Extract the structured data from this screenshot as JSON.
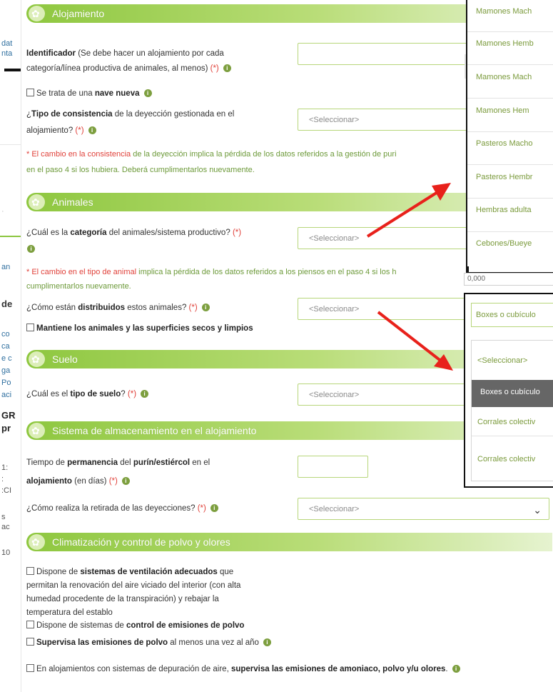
{
  "left_fragments": [
    "dat",
    "nta",
    "an",
    "de",
    "co",
    "ca",
    "e c",
    "ga",
    "Po",
    "aci",
    "GR",
    "pr",
    "1:",
    ":",
    ":CI",
    "s",
    "ac",
    "10"
  ],
  "sections": {
    "alojamiento": "Alojamiento",
    "animales": "Animales",
    "suelo": "Suelo",
    "almacenamiento": "Sistema de almacenamiento en el alojamiento",
    "climatizacion": "Climatización y control de polvo y olores"
  },
  "alojamiento": {
    "identificador_label": "Identificador",
    "identificador_note_1": " (Se debe hacer un alojamiento por cada",
    "identificador_note_2": "categoría/línea productiva de animales, al menos)",
    "required_mark": "(*)",
    "nave_nueva_prefix": "Se trata de una ",
    "nave_nueva_bold": "nave nueva",
    "tipo_pre": "¿",
    "tipo_bold": "Tipo de consistencia",
    "tipo_post": " de la deyección gestionada en el",
    "tipo_line2": "alojamiento?",
    "tipo_select": "<Seleccionar>",
    "warn_red": "* El cambio en la consistencia",
    "warn_green_1": " de la deyección implica la pérdida de los datos referidos a la gestión de puri",
    "warn_green_2": "en el paso 4 si los hubiera. Deberá cumplimentarlos nuevamente."
  },
  "animales": {
    "categoria_pre": "¿Cuál es la ",
    "categoria_bold": "categoría",
    "categoria_post": " del animales/sistema productivo?",
    "categoria_select": "<Seleccionar>",
    "warn_red": "* El cambio en el tipo de animal",
    "warn_green_1": " implica la pérdida de los datos referidos a los piensos en el paso 4 si los h",
    "warn_green_2": "cumplimentarlos nuevamente.",
    "distribuidos_pre": "¿Cómo están ",
    "distribuidos_bold": "distribuidos",
    "distribuidos_post": " estos animales?",
    "distribuidos_select": "<Seleccionar>",
    "secos_label": "Mantiene los animales y las superficies secos y limpios"
  },
  "suelo": {
    "tipo_pre": "¿Cuál es el ",
    "tipo_bold": "tipo de suelo",
    "tipo_post": "?",
    "tipo_select": "<Seleccionar>"
  },
  "almacenamiento": {
    "tiempo_pre": "Tiempo de ",
    "tiempo_bold1": "permanencia",
    "tiempo_mid": " del ",
    "tiempo_bold2": "purín/estiércol",
    "tiempo_post": " en el",
    "tiempo_line2_bold": "alojamiento",
    "tiempo_line2_post": " (en días)",
    "retirada_label": "¿Cómo realiza la retirada de las deyecciones?",
    "retirada_select": "<Seleccionar>"
  },
  "climatizacion": {
    "vent_pre": "Dispone de ",
    "vent_bold": "sistemas de ventilación adecuados",
    "vent_post": " que",
    "vent_line2": "permitan la renovación del aire viciado del interior (con alta",
    "vent_line3": "humedad procedente de la transpiración) y rebajar la",
    "vent_line4": "temperatura del establo",
    "polvo_pre": "Dispone de sistemas de ",
    "polvo_bold": "control de emisiones de polvo",
    "supervisa_bold": "Supervisa las emisiones de polvo",
    "supervisa_post": " al menos una vez al año",
    "depuracion_pre": "En alojamientos con sistemas de depuración de aire, ",
    "depuracion_bold": "supervisa las emisiones de amoniaco, polvo y/u olores",
    "depuracion_post": "."
  },
  "popup_categoria": {
    "options": [
      "Mamones Mach",
      "Mamones Hemb",
      "Mamones Mach",
      "Mamones Hem",
      "Pasteros Macho",
      "Pasteros Hembr",
      "Hembras adulta",
      "Cebones/Bueye"
    ],
    "footer_value": "0,000"
  },
  "popup_distribucion": {
    "selected_display": "Boxes o cubículo",
    "options": [
      "<Seleccionar>",
      "Boxes o cubículo",
      "Corrales colectiv",
      "Corrales colectiv"
    ],
    "highlighted_index": 1
  },
  "colors": {
    "accent_green": "#8ec73f",
    "required_red": "#e0413a",
    "warning_green": "#6d9a3a",
    "arrow_red": "#e8211b"
  },
  "icons": [
    "flower-icon",
    "info-icon",
    "checkbox-icon",
    "chevron-down-icon",
    "arrow-icon"
  ]
}
